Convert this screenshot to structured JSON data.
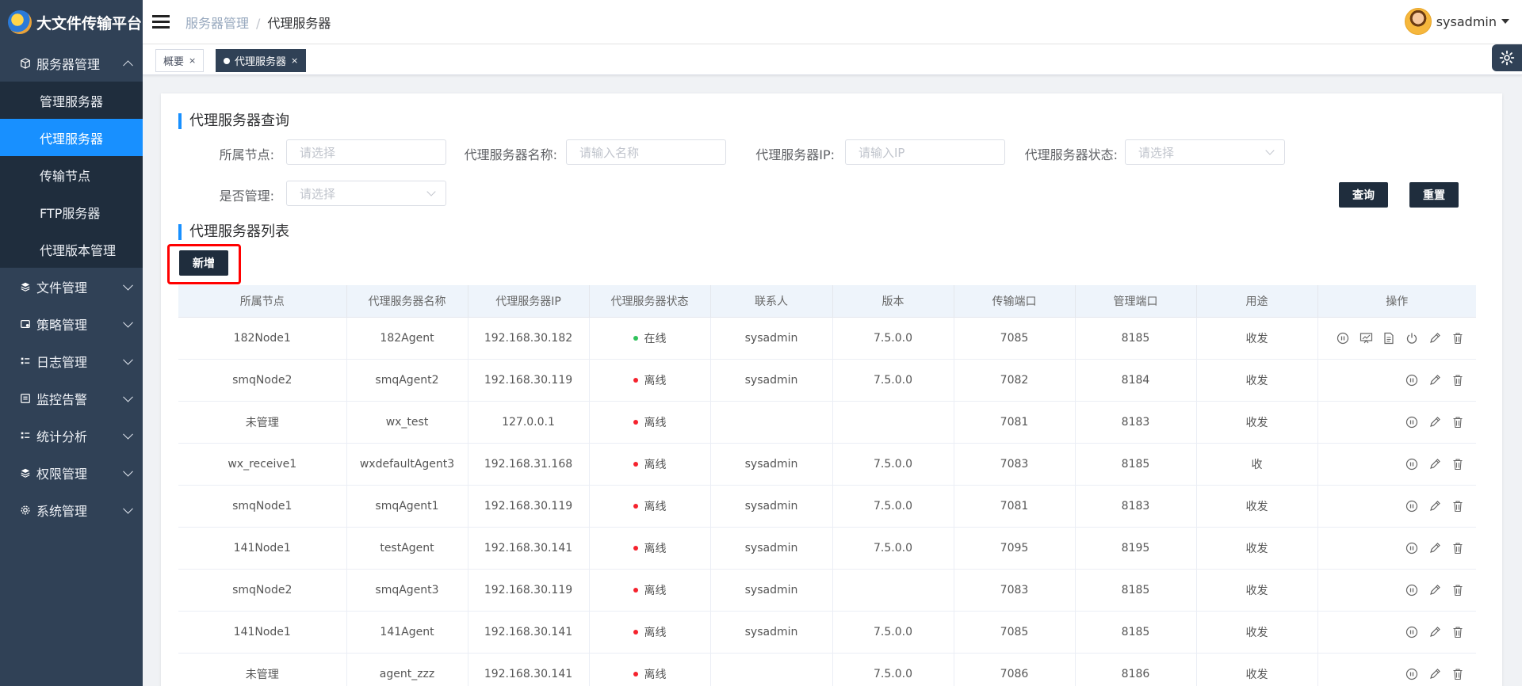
{
  "app": {
    "title": "大文件传输平台"
  },
  "sidebar": {
    "groups": [
      {
        "label": "服务器管理",
        "icon": "cube-icon",
        "expanded": true,
        "children": [
          {
            "label": "管理服务器",
            "active": false
          },
          {
            "label": "代理服务器",
            "active": true
          },
          {
            "label": "传输节点",
            "active": false
          },
          {
            "label": "FTP服务器",
            "active": false
          },
          {
            "label": "代理版本管理",
            "active": false
          }
        ]
      },
      {
        "label": "文件管理",
        "icon": "layers-icon",
        "expanded": false
      },
      {
        "label": "策略管理",
        "icon": "settings-grid-icon",
        "expanded": false
      },
      {
        "label": "日志管理",
        "icon": "log-list-icon",
        "expanded": false
      },
      {
        "label": "监控告警",
        "icon": "monitor-icon",
        "expanded": false
      },
      {
        "label": "统计分析",
        "icon": "chart-list-icon",
        "expanded": false
      },
      {
        "label": "权限管理",
        "icon": "layers-icon",
        "expanded": false
      },
      {
        "label": "系统管理",
        "icon": "gear-icon",
        "expanded": false
      }
    ]
  },
  "header": {
    "breadcrumb": [
      "服务器管理",
      "代理服务器"
    ],
    "breadcrumb_sep": "/",
    "user": "sysadmin"
  },
  "tags": [
    {
      "label": "概要",
      "active": false,
      "close": "×"
    },
    {
      "label": "代理服务器",
      "active": true,
      "close": "×"
    }
  ],
  "query": {
    "title": "代理服务器查询",
    "fields": [
      {
        "label": "所属节点:",
        "placeholder": "请选择",
        "type": "input"
      },
      {
        "label": "代理服务器名称:",
        "placeholder": "请输入名称",
        "type": "input"
      },
      {
        "label": "代理服务器IP:",
        "placeholder": "请输入IP",
        "type": "input"
      },
      {
        "label": "代理服务器状态:",
        "placeholder": "请选择",
        "type": "select"
      },
      {
        "label": "是否管理:",
        "placeholder": "请选择",
        "type": "select"
      }
    ],
    "search_label": "查询",
    "reset_label": "重置"
  },
  "list": {
    "title": "代理服务器列表",
    "add_label": "新增",
    "columns": [
      "所属节点",
      "代理服务器名称",
      "代理服务器IP",
      "代理服务器状态",
      "联系人",
      "版本",
      "传输端口",
      "管理端口",
      "用途",
      "操作"
    ],
    "rows": [
      {
        "node": "182Node1",
        "name": "182Agent",
        "ip": "192.168.30.182",
        "status": "在线",
        "online": true,
        "contact": "sysadmin",
        "version": "7.5.0.0",
        "tport": "7085",
        "mport": "8185",
        "usage": "收发",
        "full_ops": true
      },
      {
        "node": "smqNode2",
        "name": "smqAgent2",
        "ip": "192.168.30.119",
        "status": "离线",
        "online": false,
        "contact": "sysadmin",
        "version": "7.5.0.0",
        "tport": "7082",
        "mport": "8184",
        "usage": "收发",
        "full_ops": false
      },
      {
        "node": "未管理",
        "name": "wx_test",
        "ip": "127.0.0.1",
        "status": "离线",
        "online": false,
        "contact": "",
        "version": "",
        "tport": "7081",
        "mport": "8183",
        "usage": "收发",
        "full_ops": false
      },
      {
        "node": "wx_receive1",
        "name": "wxdefaultAgent3",
        "ip": "192.168.31.168",
        "status": "离线",
        "online": false,
        "contact": "sysadmin",
        "version": "7.5.0.0",
        "tport": "7083",
        "mport": "8185",
        "usage": "收",
        "full_ops": false
      },
      {
        "node": "smqNode1",
        "name": "smqAgent1",
        "ip": "192.168.30.119",
        "status": "离线",
        "online": false,
        "contact": "sysadmin",
        "version": "7.5.0.0",
        "tport": "7081",
        "mport": "8183",
        "usage": "收发",
        "full_ops": false
      },
      {
        "node": "141Node1",
        "name": "testAgent",
        "ip": "192.168.30.141",
        "status": "离线",
        "online": false,
        "contact": "sysadmin",
        "version": "7.5.0.0",
        "tport": "7095",
        "mport": "8195",
        "usage": "收发",
        "full_ops": false
      },
      {
        "node": "smqNode2",
        "name": "smqAgent3",
        "ip": "192.168.30.119",
        "status": "离线",
        "online": false,
        "contact": "sysadmin",
        "version": "",
        "tport": "7083",
        "mport": "8185",
        "usage": "收发",
        "full_ops": false
      },
      {
        "node": "141Node1",
        "name": "141Agent",
        "ip": "192.168.30.141",
        "status": "离线",
        "online": false,
        "contact": "sysadmin",
        "version": "7.5.0.0",
        "tport": "7085",
        "mport": "8185",
        "usage": "收发",
        "full_ops": false
      },
      {
        "node": "未管理",
        "name": "agent_zzz",
        "ip": "192.168.30.141",
        "status": "离线",
        "online": false,
        "contact": "",
        "version": "7.5.0.0",
        "tport": "7086",
        "mport": "8186",
        "usage": "收发",
        "full_ops": false
      }
    ]
  },
  "colors": {
    "sidebar": "#304156",
    "active": "#1890ff",
    "online": "#2fc25b",
    "offline": "#f5222d",
    "dark_button": "#1f2d3d",
    "highlight": "#ff0000"
  }
}
